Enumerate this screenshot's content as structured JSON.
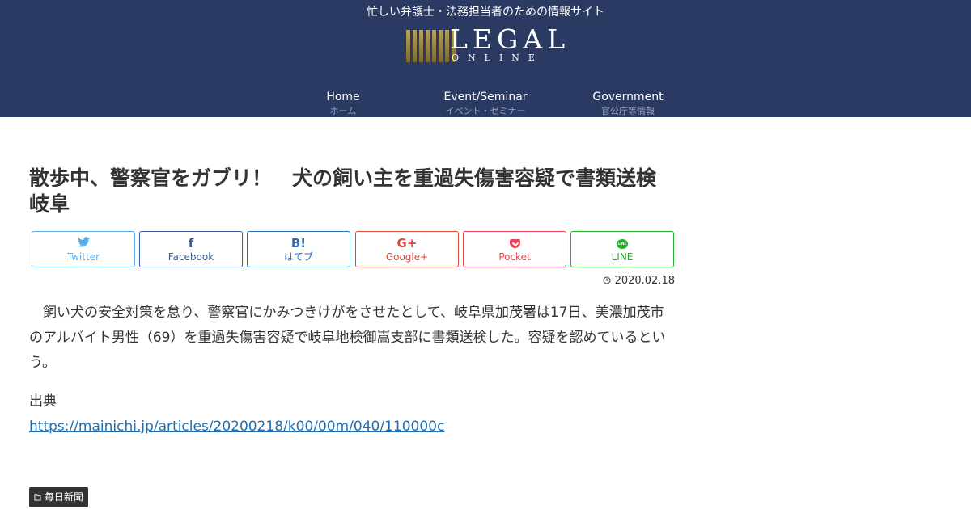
{
  "header": {
    "tagline": "忙しい弁護士・法務担当者のための情報サイト",
    "logo_title": "LEGAL",
    "logo_sub": "ONLINE"
  },
  "nav": [
    {
      "label": "Home",
      "sub": "ホーム"
    },
    {
      "label": "Event/Seminar",
      "sub": "イベント・セミナー"
    },
    {
      "label": "Government",
      "sub": "官公庁等情報"
    }
  ],
  "article": {
    "title": "散歩中、警察官をガブリ！　犬の飼い主を重過失傷害容疑で書類送検　岐阜",
    "date_icon": "clock-icon",
    "date": "2020.02.18",
    "body": "　飼い犬の安全対策を怠り、警察官にかみつきけがをさせたとして、岐阜県加茂署は17日、美濃加茂市のアルバイト男性（69）を重過失傷害容疑で岐阜地検御嵩支部に書類送検した。容疑を認めているという。",
    "source_label": "出典",
    "source_url": "https://mainichi.jp/articles/20200218/k00/00m/040/110000c",
    "tag_icon": "folder-icon",
    "tag": "毎日新聞"
  },
  "share": {
    "twitter": {
      "icon": "twitter-bird-icon",
      "label": "Twitter",
      "color": "#55acee"
    },
    "facebook": {
      "icon": "f",
      "label": "Facebook",
      "color": "#3b5998"
    },
    "hatena": {
      "icon": "B!",
      "label": "はてブ",
      "color": "#2c6ebd"
    },
    "google": {
      "icon": "G+",
      "label": "Google+",
      "color": "#dd4b39"
    },
    "pocket": {
      "icon": "pocket-icon",
      "label": "Pocket",
      "color": "#ef3f56"
    },
    "line": {
      "icon": "LINE",
      "label": "LINE",
      "color": "#1fb224"
    }
  },
  "colors": {
    "header_bg": "#2b3a62",
    "link": "#1e6eb4",
    "logo_gold": "#a38d45"
  }
}
